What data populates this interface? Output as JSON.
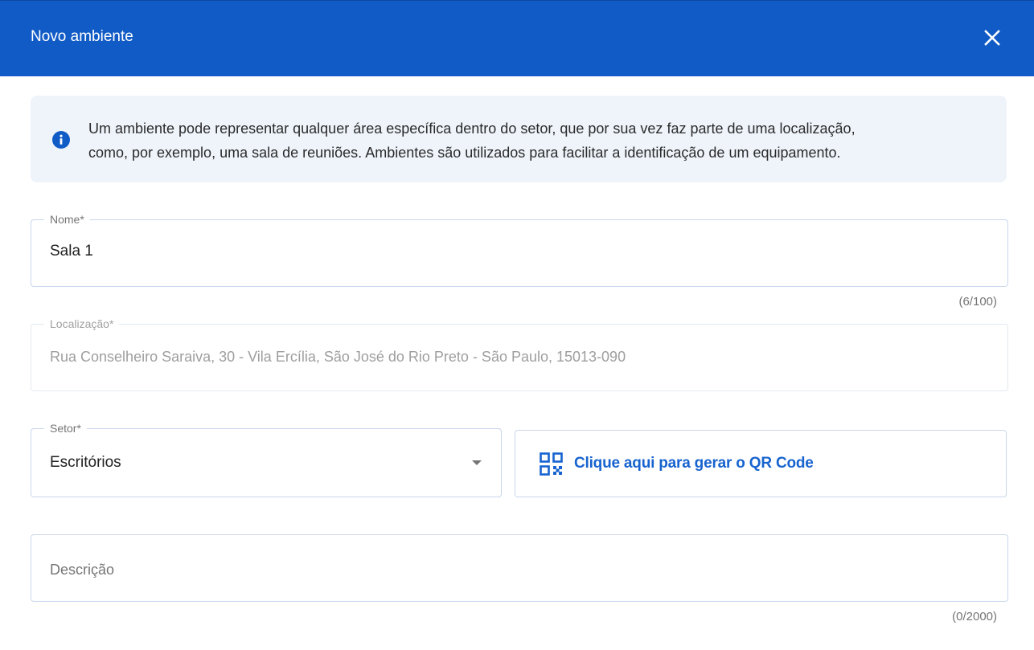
{
  "dialog": {
    "title": "Novo ambiente",
    "close_icon": "close-icon"
  },
  "info": {
    "icon": "info-icon",
    "line1": "Um ambiente pode representar qualquer área específica dentro do setor, que por sua vez faz parte de uma localização,",
    "line2": "como, por exemplo, uma sala de reuniões. Ambientes são utilizados para facilitar a identificação de um equipamento."
  },
  "form": {
    "nome": {
      "label": "Nome*",
      "value": "Sala 1",
      "counter": "(6/100)"
    },
    "localizacao": {
      "label": "Localização*",
      "value": "Rua Conselheiro Saraiva, 30 - Vila Ercília, São José do Rio Preto - São Paulo, 15013-090"
    },
    "setor": {
      "label": "Setor*",
      "value": "Escritórios"
    },
    "qr": {
      "label": "Clique aqui para gerar o QR Code",
      "icon": "qr-code-icon"
    },
    "descricao": {
      "placeholder": "Descrição",
      "counter": "(0/2000)"
    }
  },
  "colors": {
    "header_bg": "#115bc6",
    "accent": "#1763cf",
    "info_bg": "#eff4fb",
    "border": "#c9d6ec"
  }
}
